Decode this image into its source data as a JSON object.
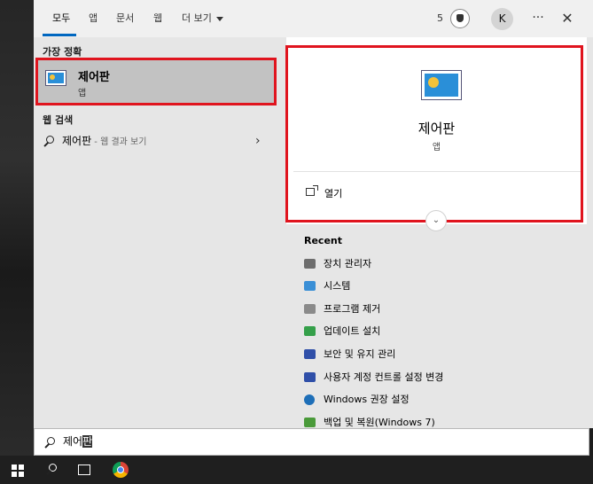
{
  "tabs": [
    {
      "label": "모두",
      "active": true
    },
    {
      "label": "앱"
    },
    {
      "label": "문서"
    },
    {
      "label": "웹"
    },
    {
      "label": "더 보기"
    }
  ],
  "header": {
    "points": "5",
    "avatar_initial": "K",
    "more": "···",
    "close": "✕"
  },
  "best_match": {
    "section": "가장 정확",
    "title": "제어판",
    "subtitle": "앱"
  },
  "web_search": {
    "section": "웹 검색",
    "query": "제어판",
    "hint": " - 웹 결과 보기",
    "chevron": "›"
  },
  "detail": {
    "title": "제어판",
    "subtitle": "앱",
    "open_label": "열기",
    "expand": "⌄"
  },
  "recent": {
    "header": "Recent",
    "items": [
      {
        "label": "장치 관리자",
        "icon": "device-manager-icon",
        "color": "#6d6d6d"
      },
      {
        "label": "시스템",
        "icon": "system-icon",
        "color": "#3a8fd6"
      },
      {
        "label": "프로그램 제거",
        "icon": "programs-icon",
        "color": "#8a8a8a"
      },
      {
        "label": "업데이트 설치",
        "icon": "update-icon",
        "color": "#35a04a"
      },
      {
        "label": "보안 및 유지 관리",
        "icon": "flag-icon",
        "color": "#2f4fa8"
      },
      {
        "label": "사용자 계정 컨트롤 설정 변경",
        "icon": "uac-flag-icon",
        "color": "#2f4fa8"
      },
      {
        "label": "Windows 권장 설정",
        "icon": "globe-icon",
        "color": "#1e6fb8"
      },
      {
        "label": "백업 및 복원(Windows 7)",
        "icon": "backup-icon",
        "color": "#4a9a3a"
      }
    ]
  },
  "search": {
    "typed": "제어",
    "selected": "판"
  }
}
